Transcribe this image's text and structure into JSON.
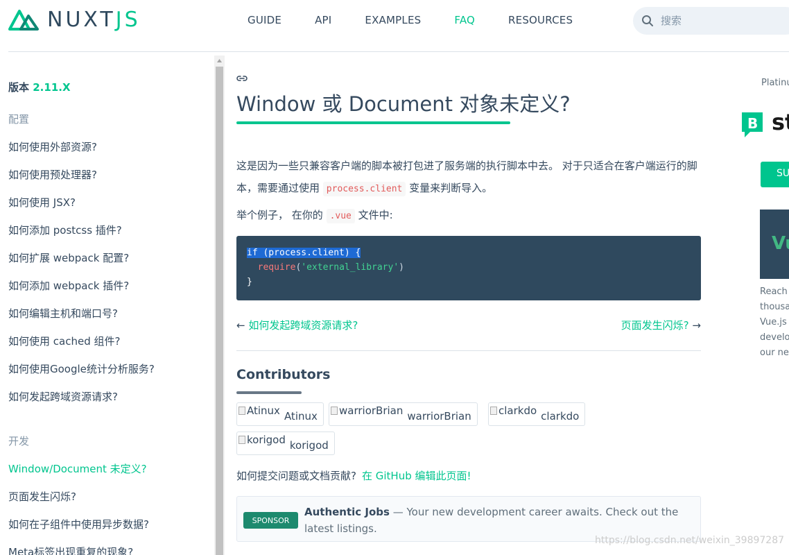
{
  "header": {
    "logo_text_main": "NUXT",
    "logo_text_accent": "JS",
    "nav": [
      "GUIDE",
      "API",
      "EXAMPLES",
      "FAQ",
      "RESOURCES"
    ],
    "active_nav": "FAQ",
    "search_placeholder": "搜索"
  },
  "sidebar": {
    "version_label": "版本",
    "version_number": "2.11.X",
    "groups": [
      {
        "title": "配置",
        "items": [
          "如何使用外部资源?",
          "如何使用预处理器?",
          "如何使用 JSX?",
          "如何添加 postcss 插件?",
          "如何扩展 webpack 配置?",
          "如何添加 webpack 插件?",
          "如何编辑主机和端口号?",
          "如何使用 cached 组件?",
          "如何使用Google统计分析服务?",
          "如何发起跨域资源请求?"
        ]
      },
      {
        "title": "开发",
        "items": [
          "Window/Document 未定义?",
          "页面发生闪烁?",
          "如何在子组件中使用异步数据?",
          "Meta标签出现重复的现象?"
        ]
      }
    ],
    "active_item": "Window/Document 未定义?"
  },
  "main": {
    "title": "Window 或 Document 对象未定义?",
    "para_before_code": "这是因为一些只兼容客户端的脚本被打包进了服务端的执行脚本中去。 对于只适合在客户端运行的脚本，需要通过使用",
    "para_inline_code": "process.client",
    "para_after_code": "变量来判断导入。",
    "example_before": "举个例子， 在你的",
    "example_code": ".vue",
    "example_after": "文件中:",
    "code": {
      "line1": "if (process.client) {",
      "line2_fn": "require",
      "line2_open": "(",
      "line2_str": "'external_library'",
      "line2_close": ")",
      "line3": "}"
    },
    "prev_arrow": "←",
    "prev_label": "如何发起跨域资源请求?",
    "next_label": "页面发生闪烁?",
    "next_arrow": "→",
    "contributors_title": "Contributors",
    "contributors": [
      "Atinux",
      "warriorBrian",
      "clarkdo",
      "korigod"
    ],
    "edit_prompt": "如何提交问题或文档贡献?",
    "edit_link": "在 GitHub 编辑此页面!",
    "sponsor": {
      "badge": "SPONSOR",
      "name": "Authentic Jobs",
      "text": " — Your new development career awaits. Check out the latest listings."
    }
  },
  "right": {
    "platinum": "Platinu",
    "brand": "st",
    "button": "SU",
    "ad_letters": "Vu",
    "ad_text_lines": [
      "Reach",
      "thousa",
      "Vue.js",
      "develo",
      "our ne"
    ]
  },
  "watermark": "https://blog.csdn.net/weixin_39897287",
  "colors": {
    "accent": "#00c58e",
    "text": "#35495e",
    "code_bg": "#2f495e"
  }
}
